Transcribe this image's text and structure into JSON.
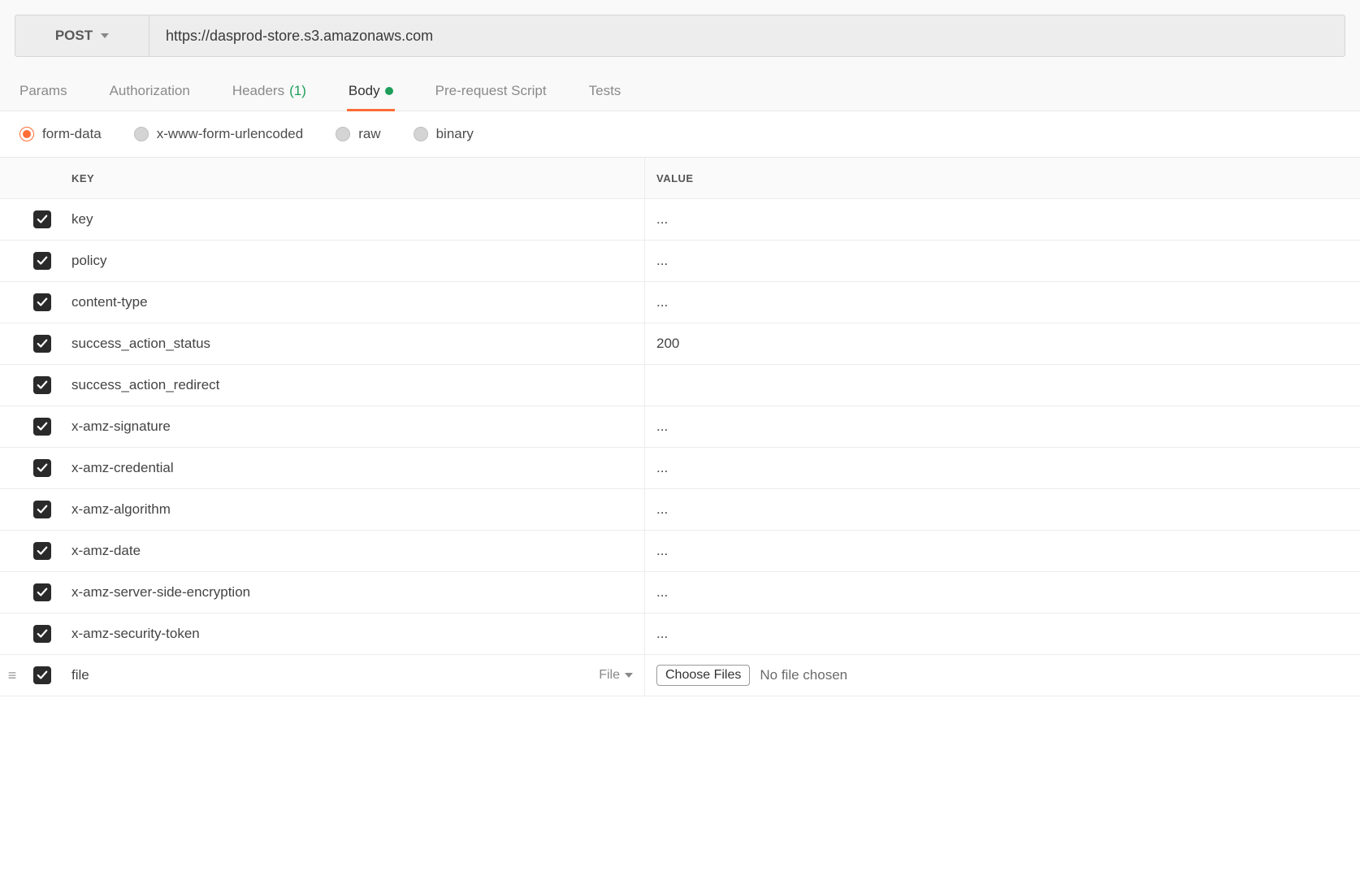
{
  "request": {
    "method": "POST",
    "url": "https://dasprod-store.s3.amazonaws.com"
  },
  "tabs": [
    {
      "label": "Params"
    },
    {
      "label": "Authorization"
    },
    {
      "label": "Headers",
      "count": "(1)"
    },
    {
      "label": "Body",
      "active": true,
      "indicator": true
    },
    {
      "label": "Pre-request Script"
    },
    {
      "label": "Tests"
    }
  ],
  "body_types": [
    {
      "label": "form-data",
      "selected": true
    },
    {
      "label": "x-www-form-urlencoded"
    },
    {
      "label": "raw"
    },
    {
      "label": "binary"
    }
  ],
  "columns": {
    "key": "KEY",
    "value": "VALUE"
  },
  "file_row": {
    "key_type_label": "File",
    "button_label": "Choose Files",
    "status": "No file chosen"
  },
  "rows": [
    {
      "checked": true,
      "key": "key",
      "value": "..."
    },
    {
      "checked": true,
      "key": "policy",
      "value": "..."
    },
    {
      "checked": true,
      "key": "content-type",
      "value": "..."
    },
    {
      "checked": true,
      "key": "success_action_status",
      "value": "200"
    },
    {
      "checked": true,
      "key": "success_action_redirect",
      "value": ""
    },
    {
      "checked": true,
      "key": "x-amz-signature",
      "value": "..."
    },
    {
      "checked": true,
      "key": "x-amz-credential",
      "value": "..."
    },
    {
      "checked": true,
      "key": "x-amz-algorithm",
      "value": "..."
    },
    {
      "checked": true,
      "key": "x-amz-date",
      "value": "..."
    },
    {
      "checked": true,
      "key": "x-amz-server-side-encryption",
      "value": "..."
    },
    {
      "checked": true,
      "key": "x-amz-security-token",
      "value": "..."
    },
    {
      "checked": true,
      "key": "file",
      "value": "",
      "type": "file",
      "drag_handle": true
    }
  ]
}
